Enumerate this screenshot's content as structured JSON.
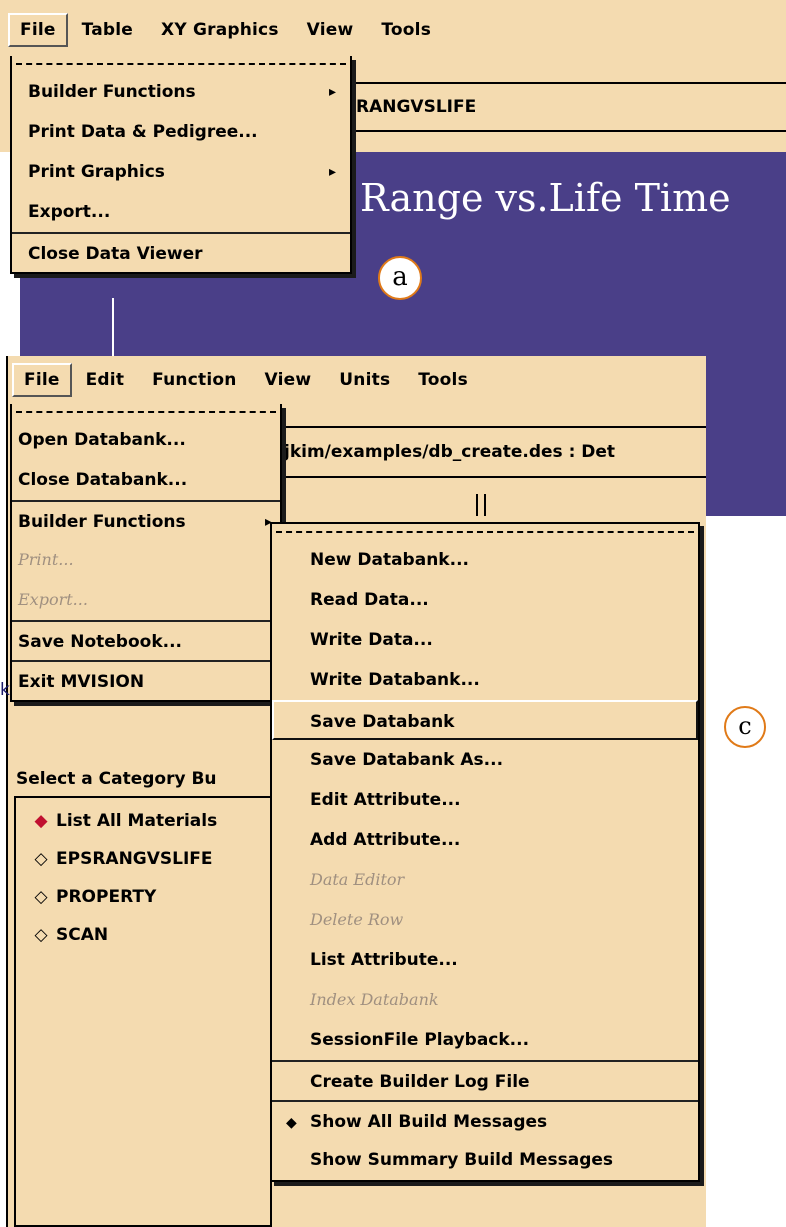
{
  "top_window": {
    "menubar": [
      "File",
      "Table",
      "XY Graphics",
      "View",
      "Tools"
    ],
    "file_menu": {
      "items": [
        {
          "label": "Builder Functions",
          "submenu": true
        },
        {
          "label": "Print Data & Pedigree..."
        },
        {
          "label": "Print Graphics",
          "submenu": true
        },
        {
          "label": "Export..."
        },
        {
          "label": "Close Data Viewer"
        }
      ]
    },
    "path_text": "RANGVSLIFE",
    "chart_title": "Range vs.Life Time",
    "callout": "a"
  },
  "bottom_window": {
    "menubar": [
      "File",
      "Edit",
      "Function",
      "View",
      "Units",
      "Tools"
    ],
    "path_text": "jkim/examples/db_create.des : Det",
    "file_menu": {
      "items": [
        {
          "label": "Open Databank..."
        },
        {
          "label": "Close Databank..."
        },
        {
          "label": "Builder Functions",
          "submenu": true
        },
        {
          "label": "Print..."
        },
        {
          "label": "Export..."
        },
        {
          "label": "Save Notebook..."
        },
        {
          "label": "Exit MVISION"
        }
      ]
    },
    "category_label": "Select a Category Bu",
    "categories": [
      {
        "label": "List All Materials",
        "selected": true
      },
      {
        "label": "EPSRANGVSLIFE"
      },
      {
        "label": "PROPERTY"
      },
      {
        "label": "SCAN"
      }
    ],
    "builder_submenu": {
      "items": [
        {
          "label": "New Databank..."
        },
        {
          "label": "Read Data..."
        },
        {
          "label": "Write Data..."
        },
        {
          "label": "Write Databank..."
        },
        {
          "label": "Save Databank",
          "highlighted": true
        },
        {
          "label": "Save Databank As..."
        },
        {
          "label": "Edit Attribute..."
        },
        {
          "label": "Add Attribute..."
        },
        {
          "label": "Data Editor",
          "disabled": true
        },
        {
          "label": "Delete Row",
          "disabled": true
        },
        {
          "label": "List Attribute..."
        },
        {
          "label": "Index Databank",
          "disabled": true
        },
        {
          "label": "SessionFile Playback..."
        },
        {
          "label": "Create Builder Log File"
        },
        {
          "label": "Show All Build Messages",
          "checked": true
        },
        {
          "label": "Show Summary Build Messages"
        }
      ]
    },
    "callout": "c",
    "stray_char": "k"
  }
}
